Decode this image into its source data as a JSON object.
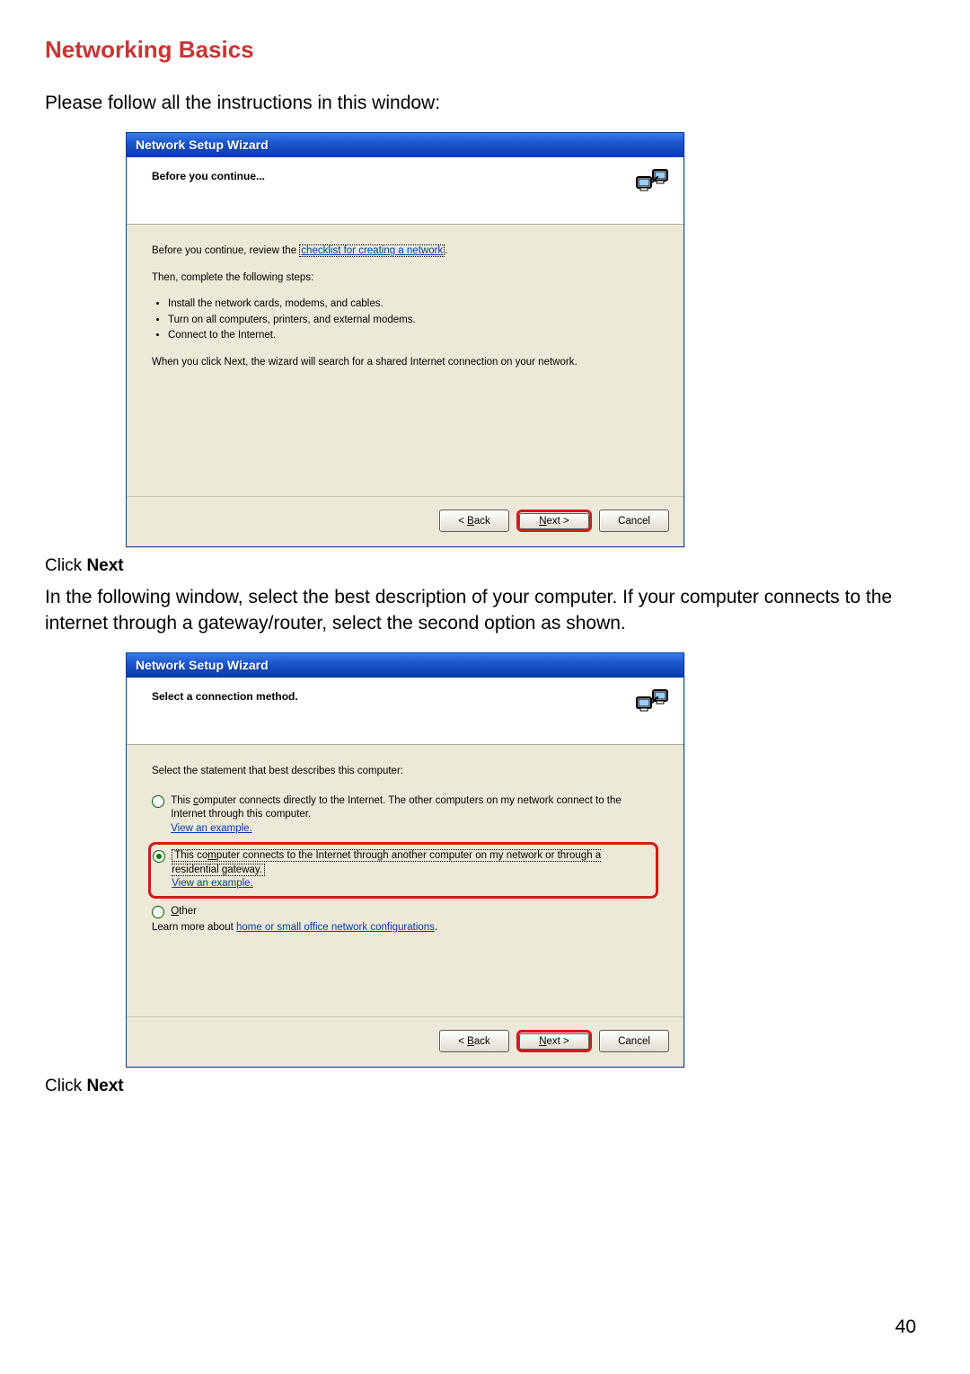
{
  "page": {
    "heading": "Networking Basics",
    "intro": "Please follow all the instructions in this window:",
    "click_next_1_prefix": "Click ",
    "click_next_1_bold": "Next",
    "between_para": "In the following window, select the best description of your computer. If your computer connects to the internet through a gateway/router, select the second option as shown.",
    "click_next_2_prefix": "Click ",
    "click_next_2_bold": "Next",
    "pagenum": "40"
  },
  "wizard1": {
    "titlebar": "Network Setup Wizard",
    "header": "Before you continue...",
    "line1_a": "Before you continue, review the ",
    "line1_link": "checklist for creating a network",
    "line1_b": ".",
    "line2": "Then, complete the following steps:",
    "bullets": [
      "Install the network cards, modems, and cables.",
      "Turn on all computers, printers, and external modems.",
      "Connect to the Internet."
    ],
    "line3": "When you click Next, the wizard will search for a shared Internet connection on your network.",
    "btn_back_a": "< ",
    "btn_back_u": "B",
    "btn_back_b": "ack",
    "btn_next_u": "N",
    "btn_next_b": "ext >",
    "btn_cancel": "Cancel"
  },
  "wizard2": {
    "titlebar": "Network Setup Wizard",
    "header": "Select a connection method.",
    "prompt": "Select the statement that best describes this computer:",
    "opt1_a": "This ",
    "opt1_u": "c",
    "opt1_b": "omputer connects directly to the Internet. The other computers on my network connect to the Internet through this computer.",
    "opt2_a": "This co",
    "opt2_u": "m",
    "opt2_b": "puter connects to the Internet through another computer on my network or through a residential gateway.",
    "opt3_u": "O",
    "opt3_b": "ther",
    "view_example": "View an example.",
    "learn_a": "Learn more about ",
    "learn_link": "home or small office network configurations",
    "learn_b": ".",
    "btn_back_a": "< ",
    "btn_back_u": "B",
    "btn_back_b": "ack",
    "btn_next_u": "N",
    "btn_next_b": "ext >",
    "btn_cancel": "Cancel"
  }
}
